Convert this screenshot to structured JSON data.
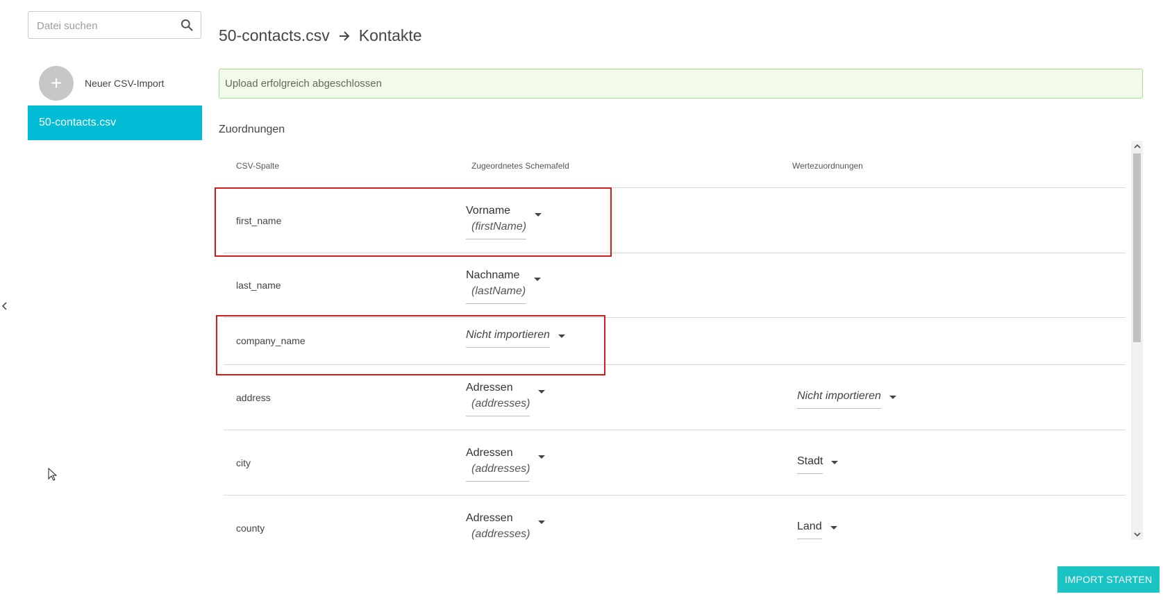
{
  "sidebar": {
    "search": {
      "placeholder": "Datei suchen",
      "value": ""
    },
    "new_import_label": "Neuer CSV-Import",
    "files": [
      {
        "label": "50-contacts.csv",
        "active": true
      }
    ]
  },
  "header": {
    "file": "50-contacts.csv",
    "target": "Kontakte"
  },
  "alert": {
    "message": "Upload erfolgreich abgeschlossen"
  },
  "mappings": {
    "title": "Zuordnungen",
    "columns": [
      "CSV-Spalte",
      "Zugeordnetes Schemafeld",
      "Wertezuordnungen"
    ],
    "rows": [
      {
        "csv": "first_name",
        "field": "Vorname",
        "field_key": "(firstName)",
        "value_map": ""
      },
      {
        "csv": "last_name",
        "field": "Nachname",
        "field_key": "(lastName)",
        "value_map": ""
      },
      {
        "csv": "company_name",
        "field": "Nicht importieren",
        "field_key": "",
        "value_map": ""
      },
      {
        "csv": "address",
        "field": "Adressen",
        "field_key": "(addresses)",
        "value_map": "Nicht importieren"
      },
      {
        "csv": "city",
        "field": "Adressen",
        "field_key": "(addresses)",
        "value_map": "Stadt"
      },
      {
        "csv": "county",
        "field": "Adressen",
        "field_key": "(addresses)",
        "value_map": "Land"
      }
    ]
  },
  "import_button": "IMPORT STARTEN",
  "colors": {
    "accent": "#00bcd4",
    "button": "#1bc4c4",
    "alert_bg": "#f2fbea",
    "alert_border": "#a9dc92",
    "highlight": "#d51b1b"
  }
}
